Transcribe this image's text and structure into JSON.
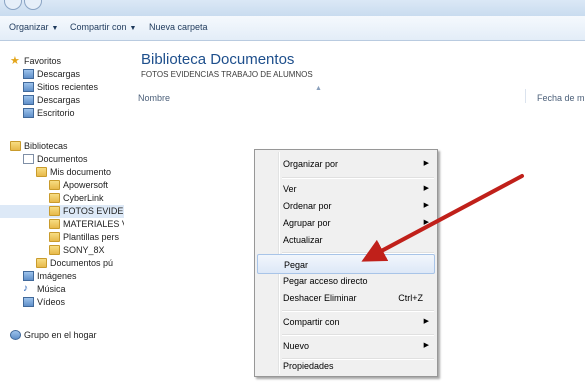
{
  "toolbar": {
    "organize": "Organizar",
    "share": "Compartir con",
    "new_folder": "Nueva carpeta"
  },
  "sidebar": {
    "favorites": "Favoritos",
    "fav_items": [
      "Descargas",
      "Sitios recientes",
      "Descargas",
      "Escritorio"
    ],
    "libraries": "Bibliotecas",
    "documents": "Documentos",
    "my_documents": "Mis documento",
    "folders": [
      "Apowersoft",
      "CyberLink",
      "FOTOS EVIDEN",
      "MATERIALES V",
      "Plantillas pers",
      "SONY_8X"
    ],
    "public_docs": "Documentos pú",
    "images": "Imágenes",
    "music": "Música",
    "videos": "Vídeos",
    "homegroup": "Grupo en el hogar"
  },
  "content": {
    "title": "Biblioteca Documentos",
    "subtitle": "FOTOS EVIDENCIAS TRABAJO DE ALUMNOS",
    "col_name": "Nombre",
    "col_date": "Fecha de m"
  },
  "context_menu": {
    "organize_by": "Organizar por",
    "view": "Ver",
    "sort_by": "Ordenar por",
    "group_by": "Agrupar por",
    "refresh": "Actualizar",
    "paste": "Pegar",
    "paste_shortcut": "Pegar acceso directo",
    "undo_delete": "Deshacer Eliminar",
    "undo_shortcut": "Ctrl+Z",
    "share_with": "Compartir con",
    "new": "Nuevo",
    "properties": "Propiedades"
  },
  "colors": {
    "title_blue": "#1e4f8c",
    "menu_highlight": "#dde8f7",
    "annotation_arrow": "#c0201a"
  }
}
